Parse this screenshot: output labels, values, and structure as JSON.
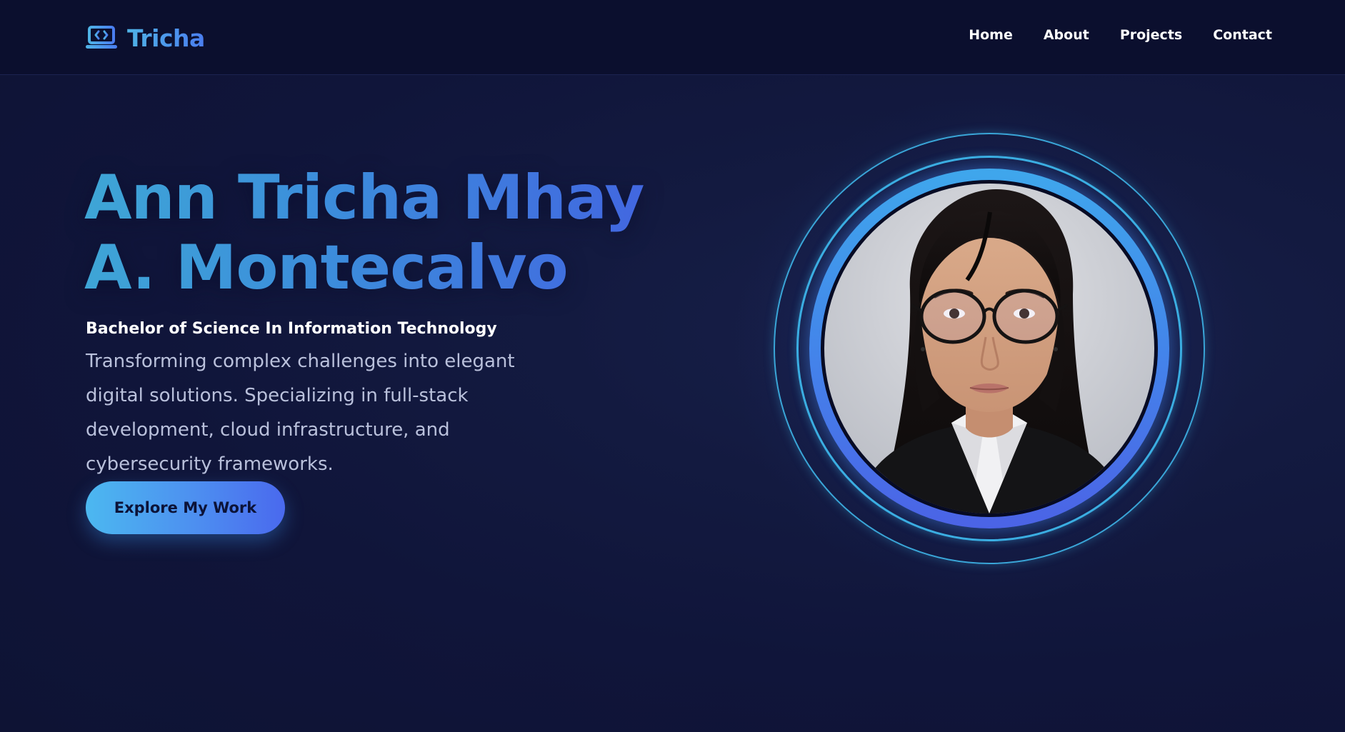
{
  "header": {
    "brand": {
      "name": "Tricha",
      "icon": "laptop-code-icon"
    },
    "nav": [
      {
        "label": "Home"
      },
      {
        "label": "About"
      },
      {
        "label": "Projects"
      },
      {
        "label": "Contact"
      }
    ]
  },
  "hero": {
    "title_line1": "Ann Tricha Mhay",
    "title_line2": "A. Montecalvo",
    "degree": "Bachelor of Science In Information Technology",
    "tagline": "Transforming complex challenges into elegant digital solutions. Specializing in full-stack development, cloud infrastructure, and cybersecurity frameworks.",
    "cta_label": "Explore My Work"
  },
  "colors": {
    "background": "#10153a",
    "header_background": "#0b0f2e",
    "accent_start": "#4cb8f0",
    "accent_end": "#4a69ee",
    "text_primary": "#ffffff",
    "text_muted": "#b9c0db"
  }
}
